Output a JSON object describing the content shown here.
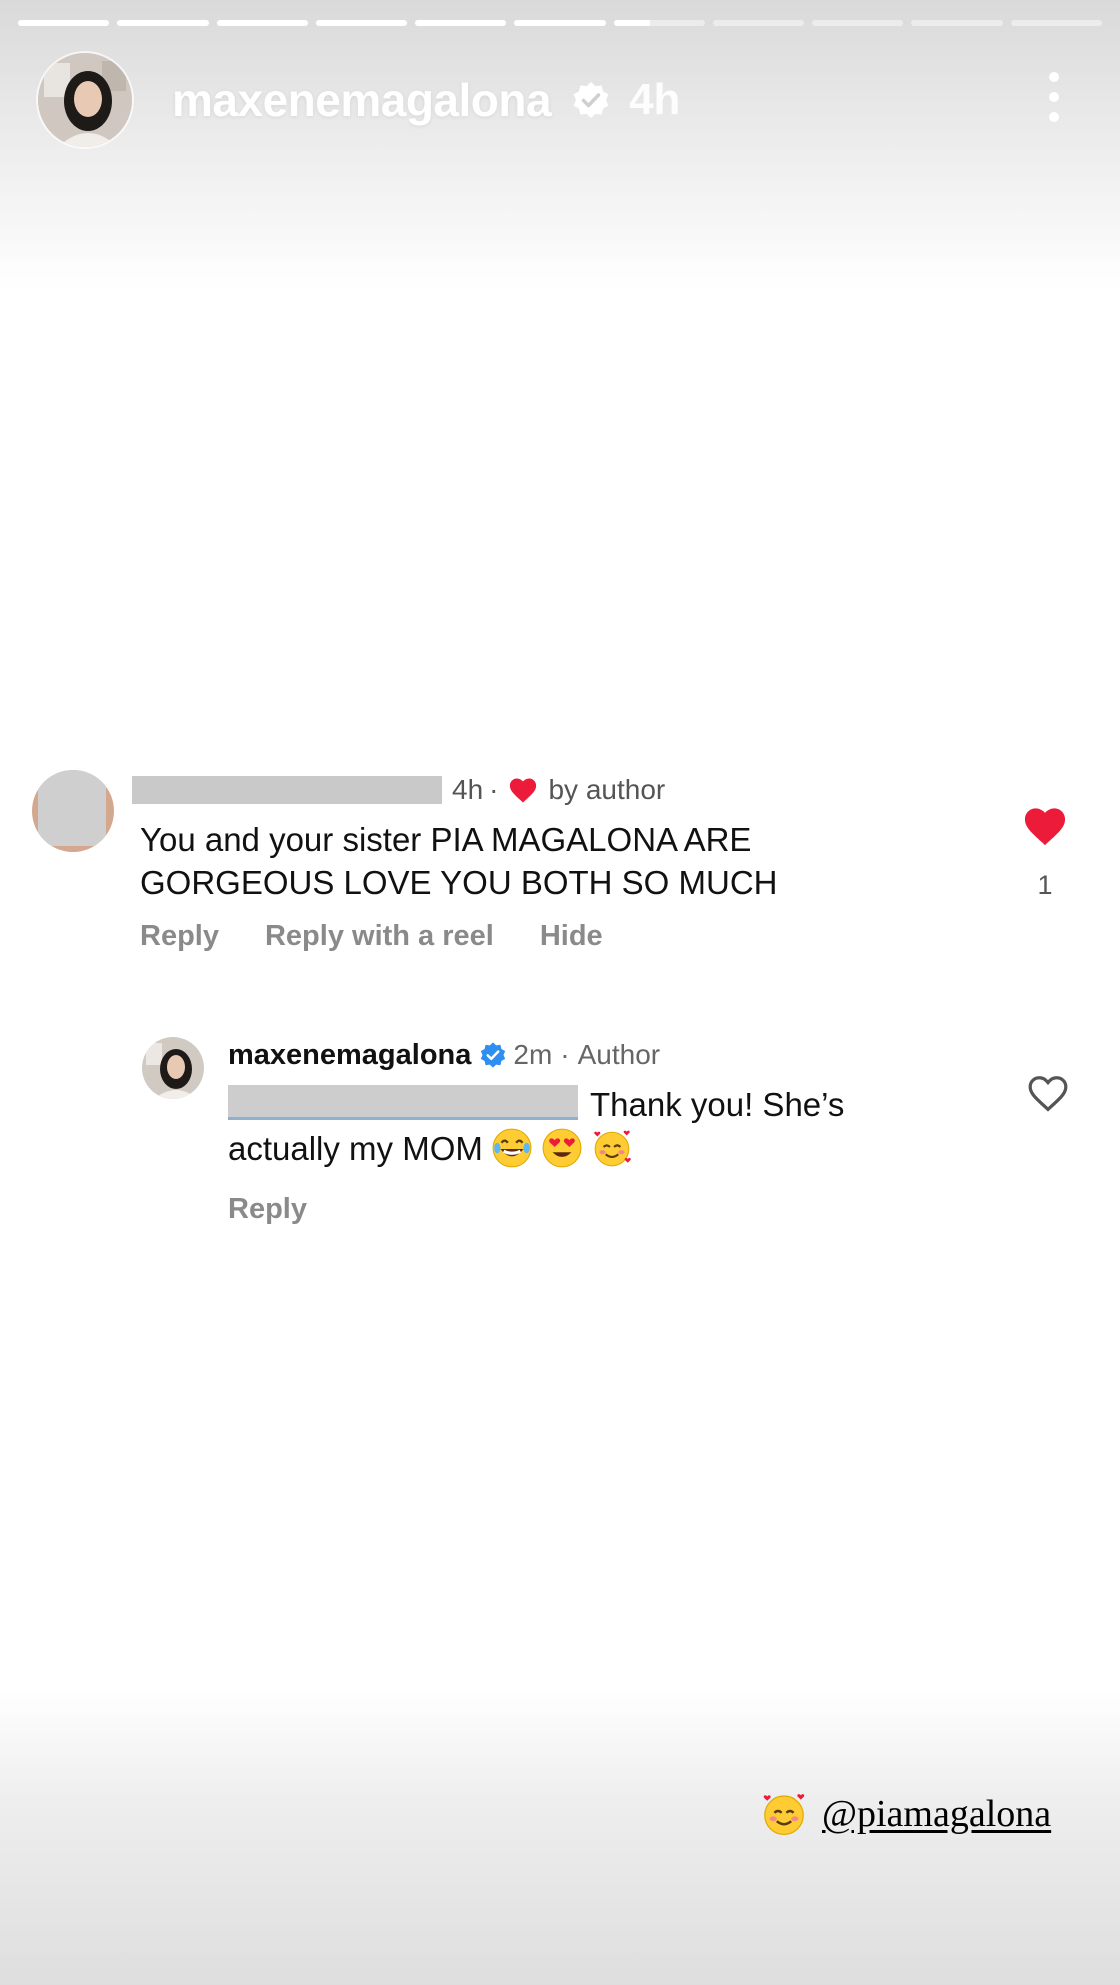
{
  "story": {
    "progress_segments": [
      1,
      1,
      1,
      1,
      1,
      1,
      0.4,
      0,
      0,
      0,
      0
    ]
  },
  "header": {
    "username": "maxenemagalona",
    "time": "4h"
  },
  "comment": {
    "time": "4h",
    "separator": "·",
    "liked_label": "by author",
    "text": "You and your sister PIA MAGALONA ARE GORGEOUS LOVE YOU BOTH SO MUCH",
    "like_count": "1",
    "actions": {
      "reply": "Reply",
      "reply_reel": "Reply with a reel",
      "hide": "Hide"
    }
  },
  "reply": {
    "username": "maxenemagalona",
    "time": "2m",
    "separator": "·",
    "author_label": "Author",
    "text_line": "Thank you! She’s actually my MOM",
    "action": "Reply"
  },
  "mention": {
    "handle": "@piamagalona"
  },
  "colors": {
    "heart_red": "#ed1b3a",
    "verified_blue": "#2f8ff0",
    "muted_gray": "#8a8a8a"
  }
}
